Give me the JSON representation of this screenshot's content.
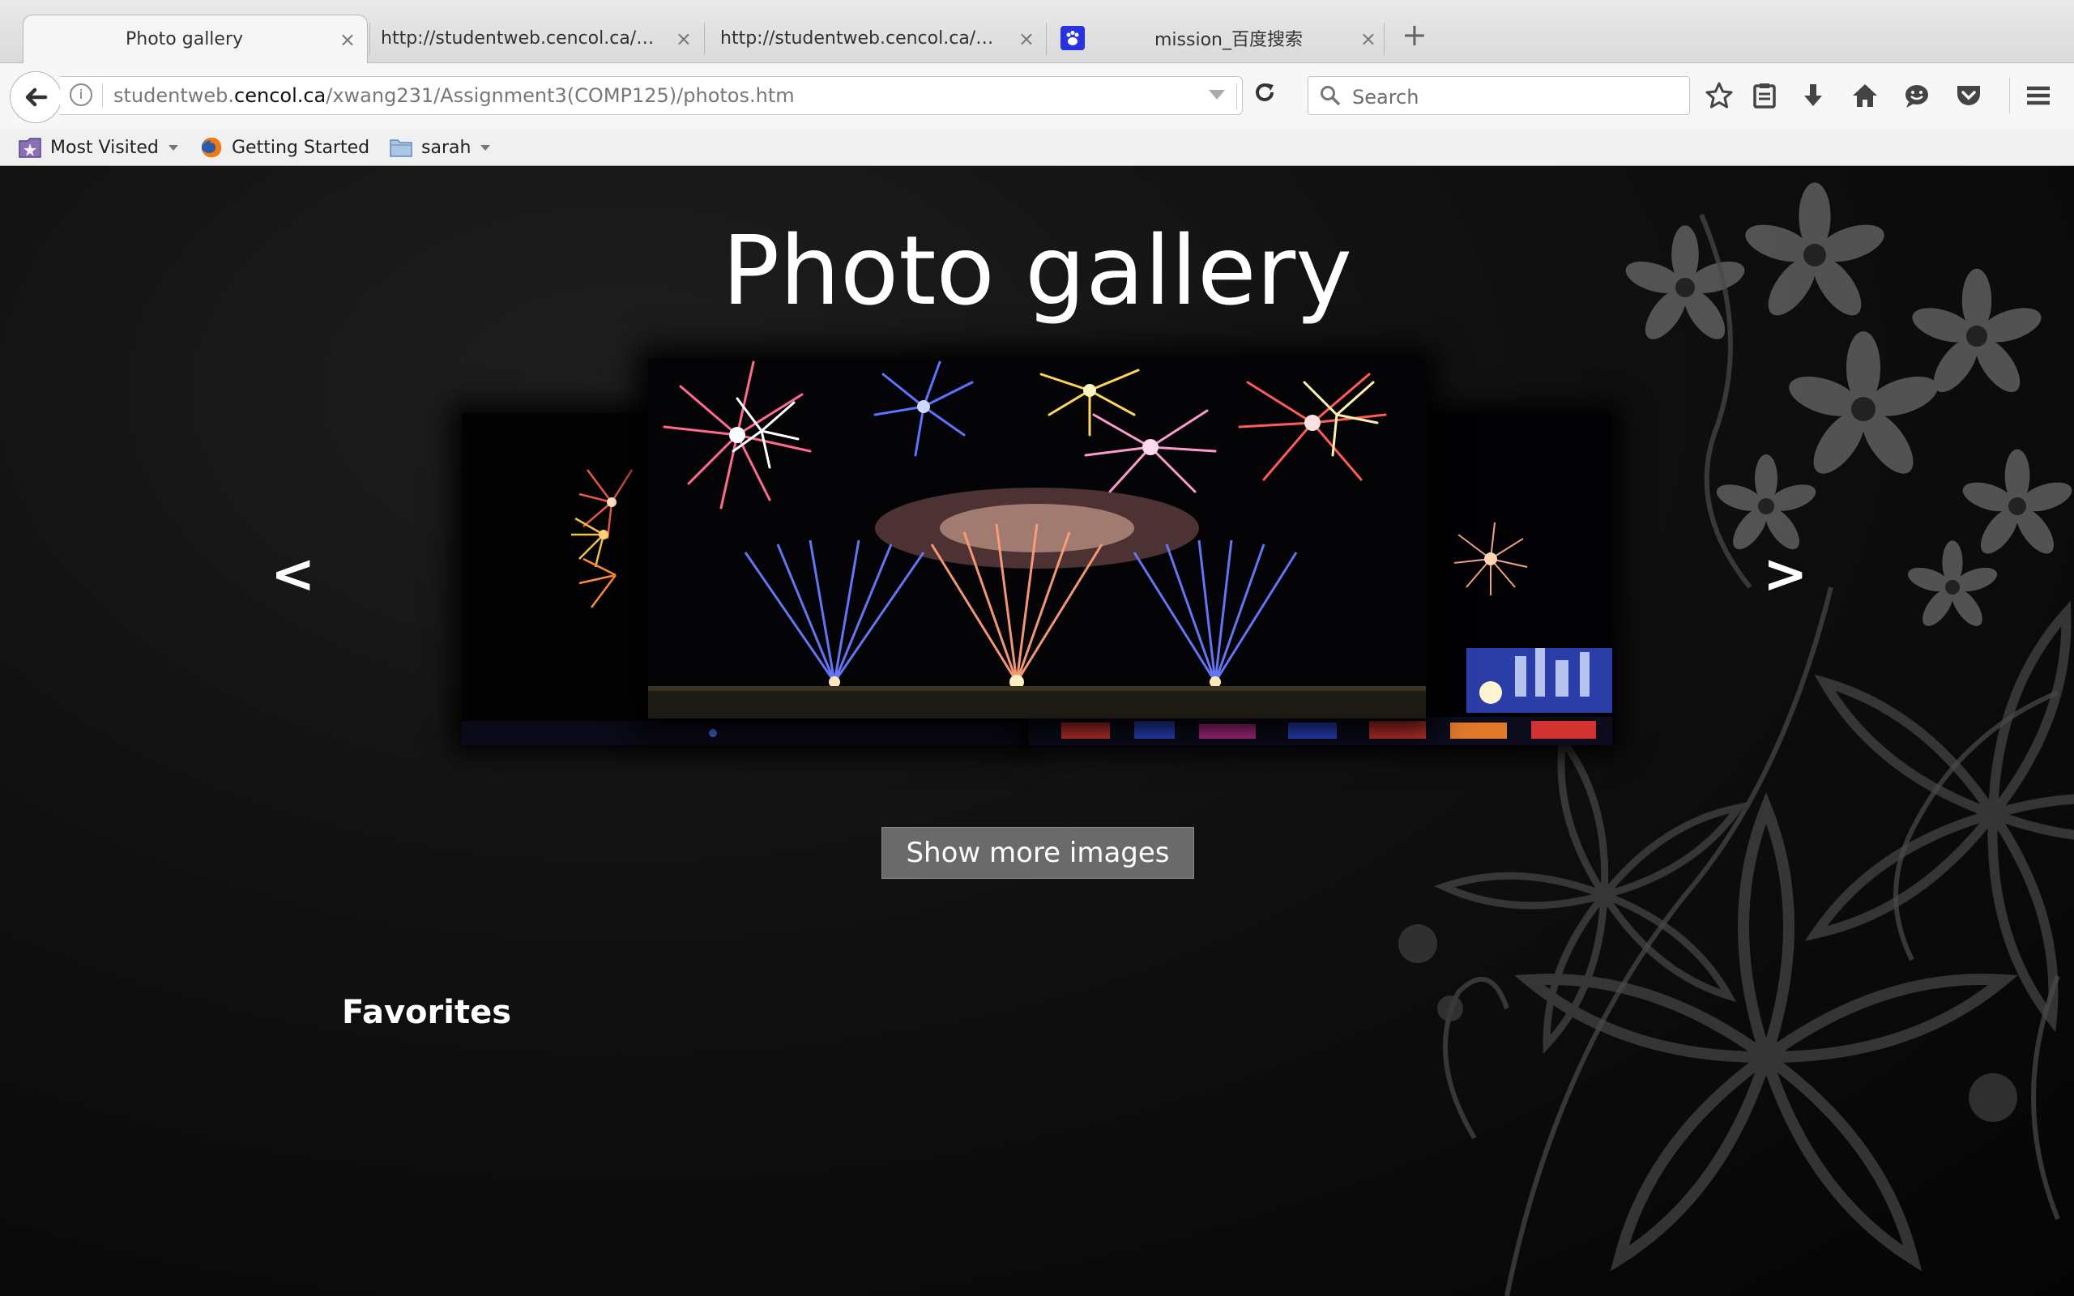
{
  "browser": {
    "tabs": [
      {
        "label": "Photo gallery",
        "active": true
      },
      {
        "label": "http://studentweb.cencol.ca/xw...",
        "active": false
      },
      {
        "label": "http://studentweb.cencol.ca/xw...",
        "active": false
      },
      {
        "label": "mission_百度搜索",
        "active": false,
        "icon": "baidu-paw-icon"
      }
    ],
    "close_glyph": "×",
    "new_tab_glyph": "+",
    "url": {
      "prefix": "studentweb.",
      "domain": "cencol.ca",
      "path": "/xwang231/Assignment3(COMP125)/photos.htm"
    },
    "search_placeholder": "Search",
    "bookmarks": [
      {
        "label": "Most Visited",
        "icon": "most-visited-icon",
        "dropdown": true
      },
      {
        "label": "Getting Started",
        "icon": "firefox-icon",
        "dropdown": false
      },
      {
        "label": "sarah",
        "icon": "folder-icon",
        "dropdown": true
      }
    ]
  },
  "page": {
    "title": "Photo gallery",
    "prev_arrow": "<",
    "next_arrow": ">",
    "show_more_label": "Show more images",
    "favorites_heading": "Favorites"
  },
  "colors": {
    "page_background": "#0b0b0b",
    "button_background": "#6a6a6a",
    "text": "#ffffff"
  }
}
